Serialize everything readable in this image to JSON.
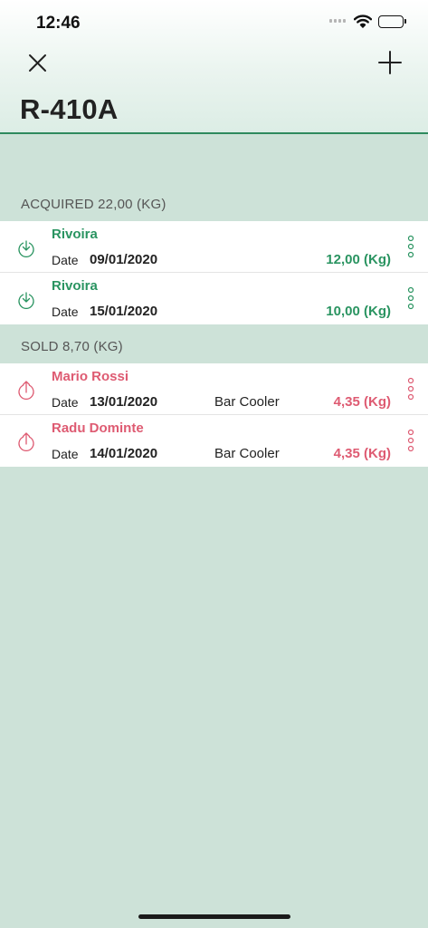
{
  "status_bar": {
    "time": "12:46"
  },
  "header": {
    "title": "R-410A"
  },
  "colors": {
    "accent_green": "#2a9461",
    "accent_red": "#de5b72",
    "background": "#cde2d8"
  },
  "acquired": {
    "header": "ACQUIRED 22,00 (KG)",
    "items": [
      {
        "name": "Rivoira",
        "date_label": "Date",
        "date": "09/01/2020",
        "location": "",
        "quantity": "12,00 (Kg)"
      },
      {
        "name": "Rivoira",
        "date_label": "Date",
        "date": "15/01/2020",
        "location": "",
        "quantity": "10,00 (Kg)"
      }
    ]
  },
  "sold": {
    "header": "SOLD 8,70 (KG)",
    "items": [
      {
        "name": "Mario Rossi",
        "date_label": "Date",
        "date": "13/01/2020",
        "location": "Bar Cooler",
        "quantity": "4,35 (Kg)"
      },
      {
        "name": "Radu Dominte",
        "date_label": "Date",
        "date": "14/01/2020",
        "location": "Bar Cooler",
        "quantity": "4,35 (Kg)"
      }
    ]
  },
  "icons": {
    "close": "close-icon",
    "add": "plus-icon",
    "acquired": "arrow-down-circle-icon",
    "sold": "arrow-up-circle-icon",
    "menu": "vertical-ellipsis-icon"
  }
}
